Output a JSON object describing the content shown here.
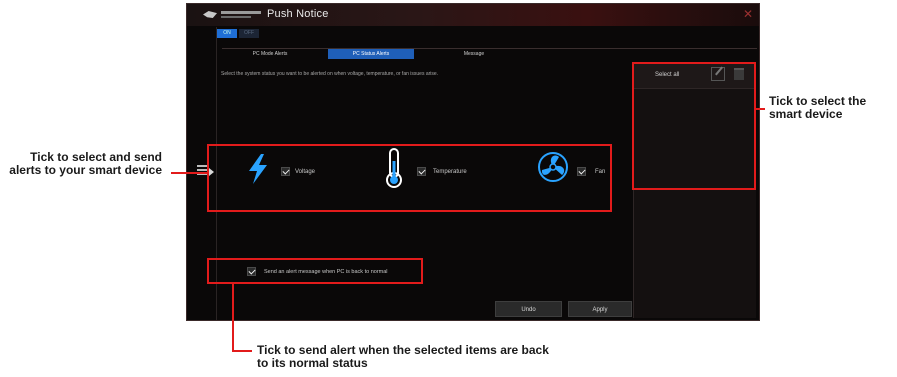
{
  "window": {
    "title": "Push Notice"
  },
  "toggle": {
    "on": "ON",
    "off": "OFF"
  },
  "tabs": [
    {
      "label": "PC Mode Alerts"
    },
    {
      "label": "PC Status Alerts"
    },
    {
      "label": "Message"
    }
  ],
  "description": "Select the system status you want to be alerted on when voltage, temperature, or fan issues arise.",
  "status_items": [
    {
      "label": "Voltage",
      "checked": true,
      "icon": "lightning-bolt-icon"
    },
    {
      "label": "Temperature",
      "checked": true,
      "icon": "thermometer-icon"
    },
    {
      "label": "Fan",
      "checked": true,
      "icon": "fan-icon"
    }
  ],
  "resume_alert": {
    "label": "Send an alert message when PC is back to normal",
    "checked": true
  },
  "buttons": {
    "undo": "Undo",
    "apply": "Apply"
  },
  "device_panel": {
    "select_all": "Select all"
  },
  "callouts": {
    "left": "Tick to select and send alerts to your smart device",
    "right": "Tick to select the smart device",
    "bottom": "Tick to send alert when the selected items are back to its normal status"
  },
  "colors": {
    "accent": "#1f5fb8",
    "callout_red": "#e21b1b",
    "window_bg": "#0a0808"
  }
}
